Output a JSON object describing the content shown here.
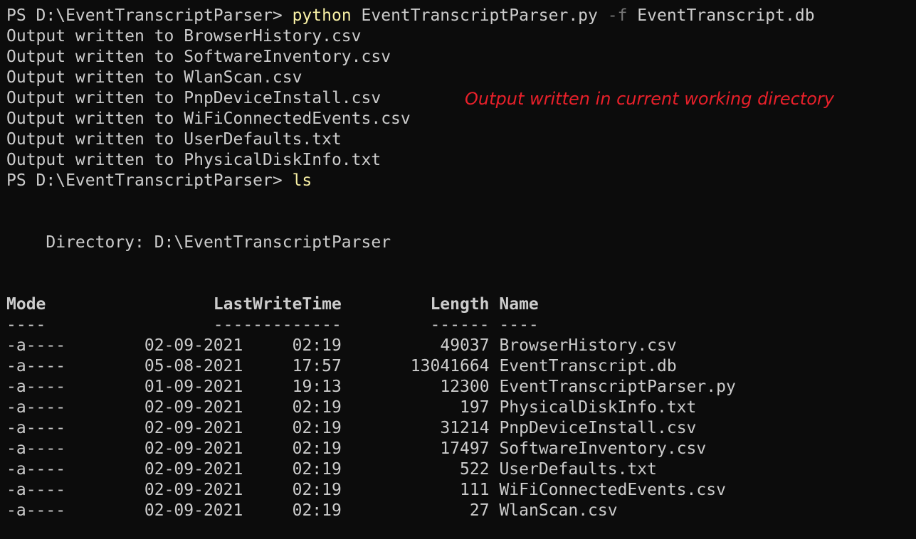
{
  "session": {
    "prompt": "PS D:\\EventTranscriptParser> ",
    "command1": {
      "program": "python",
      "script": "EventTranscriptParser.py",
      "flag": "-f",
      "file": "EventTranscript.db"
    },
    "output_lines": [
      "Output written to BrowserHistory.csv",
      "Output written to SoftwareInventory.csv",
      "Output written to WlanScan.csv",
      "Output written to PnpDeviceInstall.csv",
      "Output written to WiFiConnectedEvents.csv",
      "Output written to UserDefaults.txt",
      "Output written to PhysicalDiskInfo.txt"
    ],
    "command2": "ls",
    "directory_label": "    Directory: D:\\EventTranscriptParser"
  },
  "annotation": {
    "text": "Output written in current working directory",
    "color": "#e8202a"
  },
  "listing": {
    "headers": {
      "mode": "Mode",
      "lastwritetime": "LastWriteTime",
      "length": "Length",
      "name": "Name"
    },
    "separators": {
      "mode": "----",
      "lastwritetime": "-------------",
      "length": "------",
      "name": "----"
    },
    "rows": [
      {
        "mode": "-a----",
        "date": "02-09-2021",
        "time": "02:19",
        "length": "49037",
        "name": "BrowserHistory.csv"
      },
      {
        "mode": "-a----",
        "date": "05-08-2021",
        "time": "17:57",
        "length": "13041664",
        "name": "EventTranscript.db"
      },
      {
        "mode": "-a----",
        "date": "01-09-2021",
        "time": "19:13",
        "length": "12300",
        "name": "EventTranscriptParser.py"
      },
      {
        "mode": "-a----",
        "date": "02-09-2021",
        "time": "02:19",
        "length": "197",
        "name": "PhysicalDiskInfo.txt"
      },
      {
        "mode": "-a----",
        "date": "02-09-2021",
        "time": "02:19",
        "length": "31214",
        "name": "PnpDeviceInstall.csv"
      },
      {
        "mode": "-a----",
        "date": "02-09-2021",
        "time": "02:19",
        "length": "17497",
        "name": "SoftwareInventory.csv"
      },
      {
        "mode": "-a----",
        "date": "02-09-2021",
        "time": "02:19",
        "length": "522",
        "name": "UserDefaults.txt"
      },
      {
        "mode": "-a----",
        "date": "02-09-2021",
        "time": "02:19",
        "length": "111",
        "name": "WiFiConnectedEvents.csv"
      },
      {
        "mode": "-a----",
        "date": "02-09-2021",
        "time": "02:19",
        "length": "27",
        "name": "WlanScan.csv"
      }
    ]
  },
  "colors": {
    "background": "#0c0c0c",
    "foreground": "#cccccc",
    "command": "#f9f1a5",
    "flag": "#767676"
  }
}
